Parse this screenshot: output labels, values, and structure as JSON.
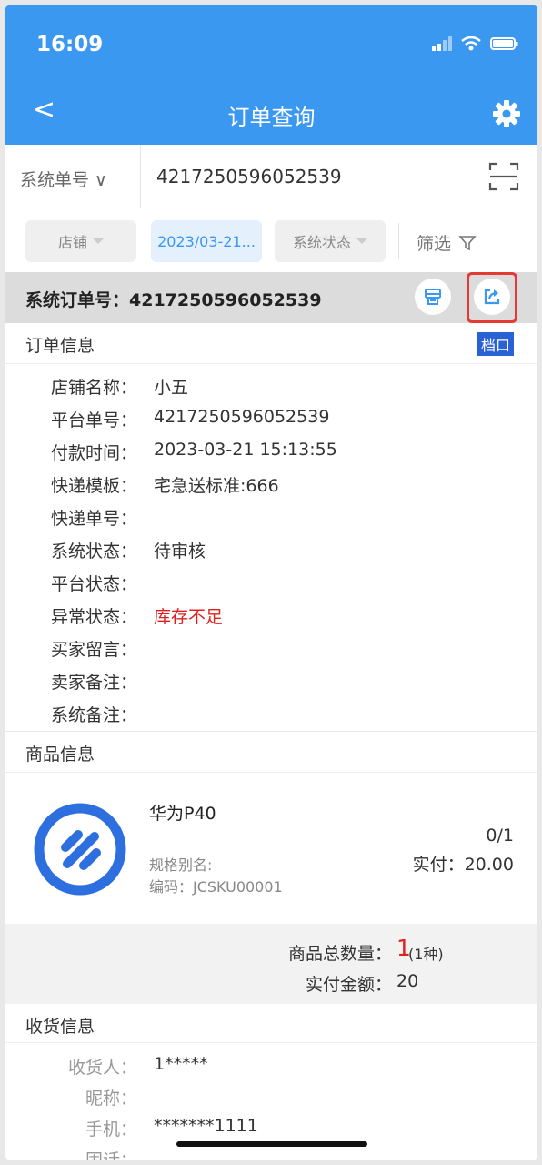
{
  "status_bar": {
    "time": "16:09"
  },
  "nav": {
    "back": "<",
    "title": "订单查询"
  },
  "search": {
    "type_label": "系统单号 ∨",
    "value": "4217250596052539"
  },
  "filters": {
    "shop": "店铺",
    "date": "2023/03-21...",
    "sys_status": "系统状态",
    "filter": "筛选"
  },
  "order_header": {
    "label": "系统订单号：",
    "number": "4217250596052539"
  },
  "order_info": {
    "title": "订单信息",
    "tag": "档口",
    "rows": [
      {
        "k": "店铺名称：",
        "v": "小五"
      },
      {
        "k": "平台单号：",
        "v": "4217250596052539"
      },
      {
        "k": "付款时间：",
        "v": "2023-03-21 15:13:55"
      },
      {
        "k": "快递模板：",
        "v": "宅急送标准:666"
      },
      {
        "k": "快递单号：",
        "v": ""
      },
      {
        "k": "系统状态：",
        "v": "待审核"
      },
      {
        "k": "平台状态：",
        "v": ""
      },
      {
        "k": "异常状态：",
        "v": "库存不足"
      },
      {
        "k": "买家留言：",
        "v": ""
      },
      {
        "k": "卖家备注：",
        "v": ""
      },
      {
        "k": "系统备注：",
        "v": ""
      }
    ]
  },
  "product_info": {
    "title": "商品信息",
    "name": "华为P40",
    "spec": "规格别名:",
    "code": "编码：JCSKU00001",
    "qty": "0/1",
    "paid": "实付：20.00"
  },
  "summary": {
    "total_label": "商品总数量：",
    "total_value": "1",
    "total_kinds": "(1种)",
    "paid_label": "实付金额：",
    "paid_value": "20"
  },
  "receiver": {
    "title": "收货信息",
    "rows": [
      {
        "k": "收货人：",
        "v": "1*****"
      },
      {
        "k": "昵称：",
        "v": ""
      },
      {
        "k": "手机：",
        "v": "*******1111"
      },
      {
        "k": "固话：",
        "v": ""
      }
    ]
  },
  "colors": {
    "primary": "#3b98f0",
    "alert": "#e02020",
    "tag": "#2a62d6",
    "highlight": "#e53935"
  }
}
